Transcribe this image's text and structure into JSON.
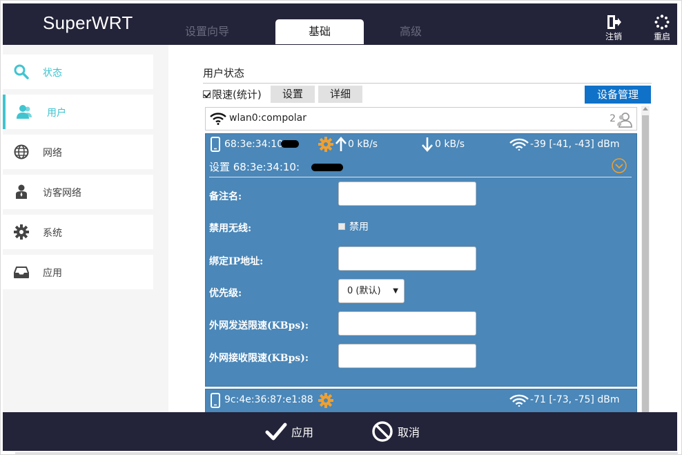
{
  "app": {
    "brand": "SuperWRT"
  },
  "tabs": [
    {
      "label": "设置向导",
      "active": false
    },
    {
      "label": "基础",
      "active": true
    },
    {
      "label": "高级",
      "active": false
    }
  ],
  "top_actions": {
    "logout": "注销",
    "restart": "重启"
  },
  "sidebar": {
    "items": [
      {
        "label": "状态",
        "icon": "search-icon"
      },
      {
        "label": "用户",
        "icon": "users-icon"
      },
      {
        "label": "网络",
        "icon": "globe-icon"
      },
      {
        "label": "访客网络",
        "icon": "guest-icon"
      },
      {
        "label": "系统",
        "icon": "gear-icon"
      },
      {
        "label": "应用",
        "icon": "inbox-icon"
      }
    ]
  },
  "main": {
    "section_title": "用户状态",
    "limit_checkbox": {
      "label": "限速(统计)",
      "checked": true
    },
    "btn_settings": "设置",
    "btn_details": "详细",
    "btn_device_mgmt": "设备管理",
    "wlan": {
      "name": "wlan0:compolar",
      "count": "2"
    },
    "device1": {
      "mac": "68:3e:34:10:",
      "upload": "0 kB/s",
      "download": "0 kB/s",
      "signal": "-39 [-41, -43] dBm",
      "settings_title": "设置 68:3e:34:10:",
      "fields": {
        "remark_label": "备注名:",
        "remark_value": "",
        "disable_wifi_label": "禁用无线:",
        "disable_wifi_option": "禁用",
        "bind_ip_label": "绑定IP地址:",
        "bind_ip_value": "",
        "priority_label": "优先级:",
        "priority_value": "0 (默认)",
        "up_limit_label": "外网发送限速(KBps):",
        "up_limit_value": "",
        "down_limit_label": "外网接收限速(KBps):",
        "down_limit_value": ""
      }
    },
    "device2": {
      "mac": "9c:4e:36:87:e1:88",
      "signal": "-71 [-73, -75] dBm"
    }
  },
  "bottom": {
    "apply": "应用",
    "cancel": "取消"
  },
  "colors": {
    "topbar": "#232339",
    "accent_cyan": "#40c4d0",
    "card_blue": "#4b87b8",
    "button_blue": "#0f72c8",
    "gear_orange": "#f0a030"
  }
}
